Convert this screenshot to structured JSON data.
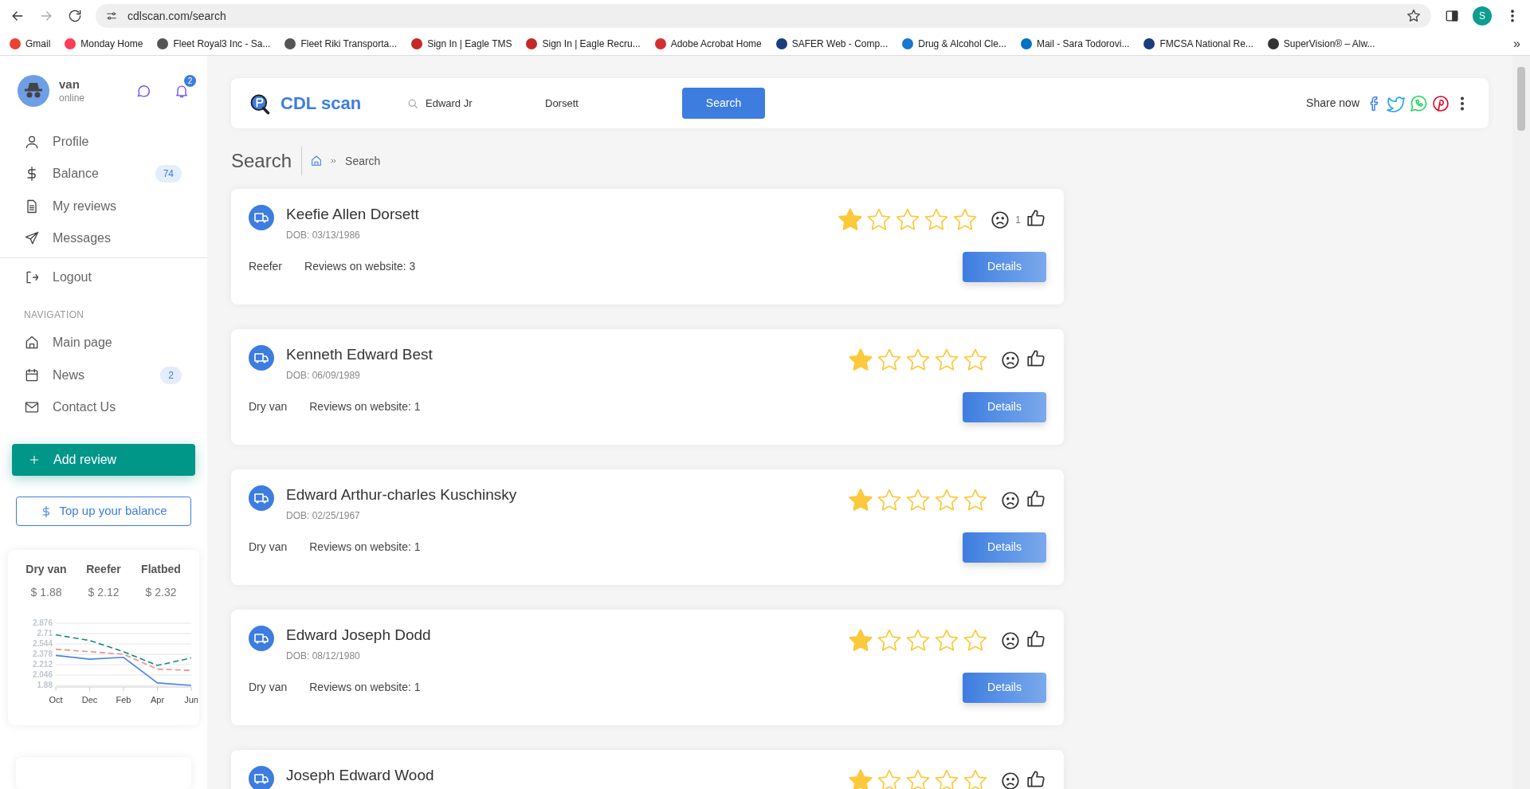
{
  "browser": {
    "url": "cdlscan.com/search",
    "profile_initial": "S",
    "bookmarks": [
      "Gmail",
      "Monday Home",
      "Fleet Royal3 Inc - Sa...",
      "Fleet Riki Transporta...",
      "Sign In | Eagle TMS",
      "Sign In | Eagle Recru...",
      "Adobe Acrobat Home",
      "SAFER Web - Comp...",
      "Drug & Alcohol Cle...",
      "Mail - Sara Todorovi...",
      "FMCSA National Re...",
      "SuperVision® – Alw..."
    ],
    "more": "»"
  },
  "sidebar": {
    "user": {
      "name": "van",
      "status": "online",
      "notifications": "2"
    },
    "menu": [
      {
        "label": "Profile"
      },
      {
        "label": "Balance",
        "badge": "74"
      },
      {
        "label": "My reviews"
      },
      {
        "label": "Messages"
      }
    ],
    "logout": "Logout",
    "nav_heading": "NAVIGATION",
    "nav": [
      {
        "label": "Main page"
      },
      {
        "label": "News",
        "badge": "2"
      },
      {
        "label": "Contact Us"
      }
    ],
    "add_review": "Add review",
    "top_up": "Top up your balance",
    "prices": [
      "$ 1.88",
      "$ 2.12",
      "$ 2.32"
    ],
    "chart_data": {
      "type": "line",
      "grid": true,
      "categories": [
        "Oct",
        "Dec",
        "Feb",
        "Apr",
        "Jun"
      ],
      "ylim": [
        1.88,
        2.876
      ],
      "yticks": [
        1.88,
        2.046,
        2.212,
        2.378,
        2.544,
        2.71,
        2.876
      ],
      "series": [
        {
          "name": "Dry van",
          "color": "#4a86e8",
          "line_style": "solid",
          "values": [
            2.36,
            2.3,
            2.33,
            1.92,
            1.88
          ]
        },
        {
          "name": "Reefer",
          "color": "#f28b82",
          "line_style": "dashed",
          "values": [
            2.46,
            2.42,
            2.38,
            2.14,
            2.12
          ]
        },
        {
          "name": "Flatbed",
          "color": "#138d75",
          "line_style": "dashed",
          "values": [
            2.69,
            2.6,
            2.42,
            2.2,
            2.32
          ]
        }
      ]
    }
  },
  "header": {
    "logo": "CDL scan",
    "first_name": "Edward Jr",
    "last_name": "Dorsett",
    "search": "Search",
    "share": "Share now"
  },
  "page_title": "Search",
  "breadcrumb": "Search",
  "results": [
    {
      "name": "Keefie Allen Dorsett",
      "dob": "DOB: 03/13/1986",
      "type": "Reefer",
      "reviews": "Reviews on website: 3",
      "stars": 1,
      "dislikes": "1",
      "details": "Details"
    },
    {
      "name": "Kenneth Edward Best",
      "dob": "DOB: 06/09/1989",
      "type": "Dry van",
      "reviews": "Reviews on website: 1",
      "stars": 1,
      "details": "Details"
    },
    {
      "name": "Edward Arthur-charles Kuschinsky",
      "dob": "DOB: 02/25/1967",
      "type": "Dry van",
      "reviews": "Reviews on website: 1",
      "stars": 1,
      "details": "Details"
    },
    {
      "name": "Edward Joseph Dodd",
      "dob": "DOB: 08/12/1980",
      "type": "Dry van",
      "reviews": "Reviews on website: 1",
      "stars": 1,
      "details": "Details"
    },
    {
      "name": "Joseph Edward Wood",
      "stars": 1
    }
  ]
}
